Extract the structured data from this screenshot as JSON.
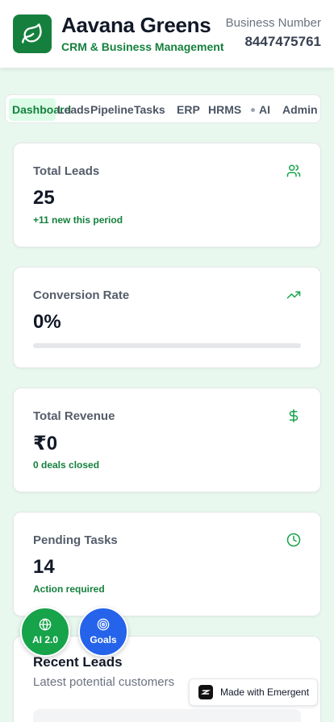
{
  "header": {
    "title": "Aavana Greens",
    "subtitle": "CRM & Business Management",
    "business_label": "Business Number",
    "business_number": "8447475761"
  },
  "tabs": [
    {
      "label": "Dashboard",
      "active": true
    },
    {
      "label": "Leads"
    },
    {
      "label": "Pipeline"
    },
    {
      "label": "Tasks"
    },
    {
      "label": "ERP"
    },
    {
      "label": "HRMS"
    },
    {
      "label": "AI"
    },
    {
      "label": "Admin"
    }
  ],
  "stats": {
    "total_leads": {
      "label": "Total Leads",
      "value": "25",
      "sub": "+11 new this period",
      "icon": "users-icon"
    },
    "conversion": {
      "label": "Conversion Rate",
      "value": "0%",
      "progress": 0,
      "icon": "trending-up-icon"
    },
    "revenue": {
      "label": "Total Revenue",
      "value": "₹0",
      "sub": "0 deals closed",
      "icon": "dollar-icon"
    },
    "pending_tasks": {
      "label": "Pending Tasks",
      "value": "14",
      "sub": "Action required",
      "icon": "clock-icon"
    }
  },
  "recent_leads": {
    "title": "Recent Leads",
    "subtitle": "Latest potential customers"
  },
  "fabs": {
    "ai": {
      "label": "AI 2.0",
      "icon": "globe-icon"
    },
    "goals": {
      "label": "Goals",
      "icon": "target-icon"
    }
  },
  "badge": {
    "label": "Made with Emergent"
  },
  "colors": {
    "brand": "#15803d",
    "accent_green": "#16a34a",
    "accent_blue": "#2563eb",
    "background": "#e8f8ef"
  }
}
